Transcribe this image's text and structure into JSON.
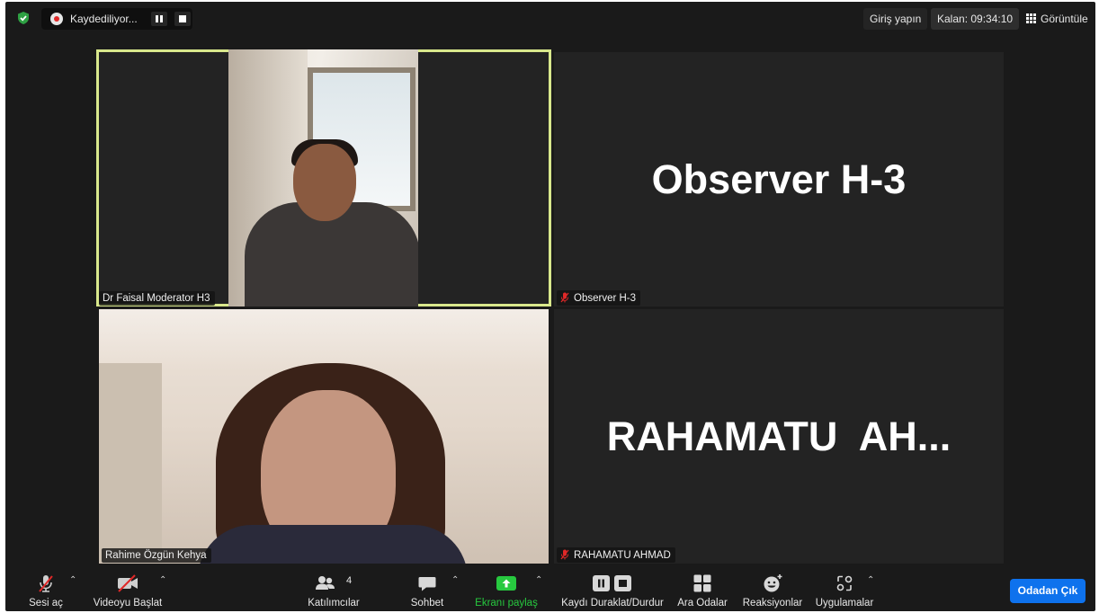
{
  "topbar": {
    "recording_label": "Kaydediliyor...",
    "signin_label": "Giriş yapın",
    "timer_label": "Kalan: 09:34:10",
    "view_label": "Görüntüle"
  },
  "tiles": [
    {
      "name": "Dr Faisal Moderator H3",
      "video": true,
      "active": true,
      "muted": false
    },
    {
      "name": "Observer H-3",
      "video": false,
      "big_name": "Observer H-3",
      "muted": true
    },
    {
      "name": "Rahime Özgün Kehya",
      "video": true,
      "muted": false
    },
    {
      "name": "RAHAMATU AHMAD",
      "video": false,
      "big_name": "RAHAMATU  AH...",
      "muted": true
    }
  ],
  "toolbar": {
    "audio_label": "Sesi aç",
    "video_label": "Videoyu Başlat",
    "participants_label": "Katılımcılar",
    "participants_count": "4",
    "chat_label": "Sohbet",
    "share_label": "Ekranı paylaş",
    "record_label": "Kaydı Duraklat/Durdur",
    "breakout_label": "Ara Odalar",
    "reactions_label": "Reaksiyonlar",
    "apps_label": "Uygulamalar",
    "leave_label": "Odadan Çık"
  },
  "colors": {
    "active_speaker_border": "#d9e88c",
    "leave_button": "#0e72ed",
    "share_green": "#27c93f",
    "muted_red": "#e02828",
    "shield_green": "#2ea043"
  }
}
